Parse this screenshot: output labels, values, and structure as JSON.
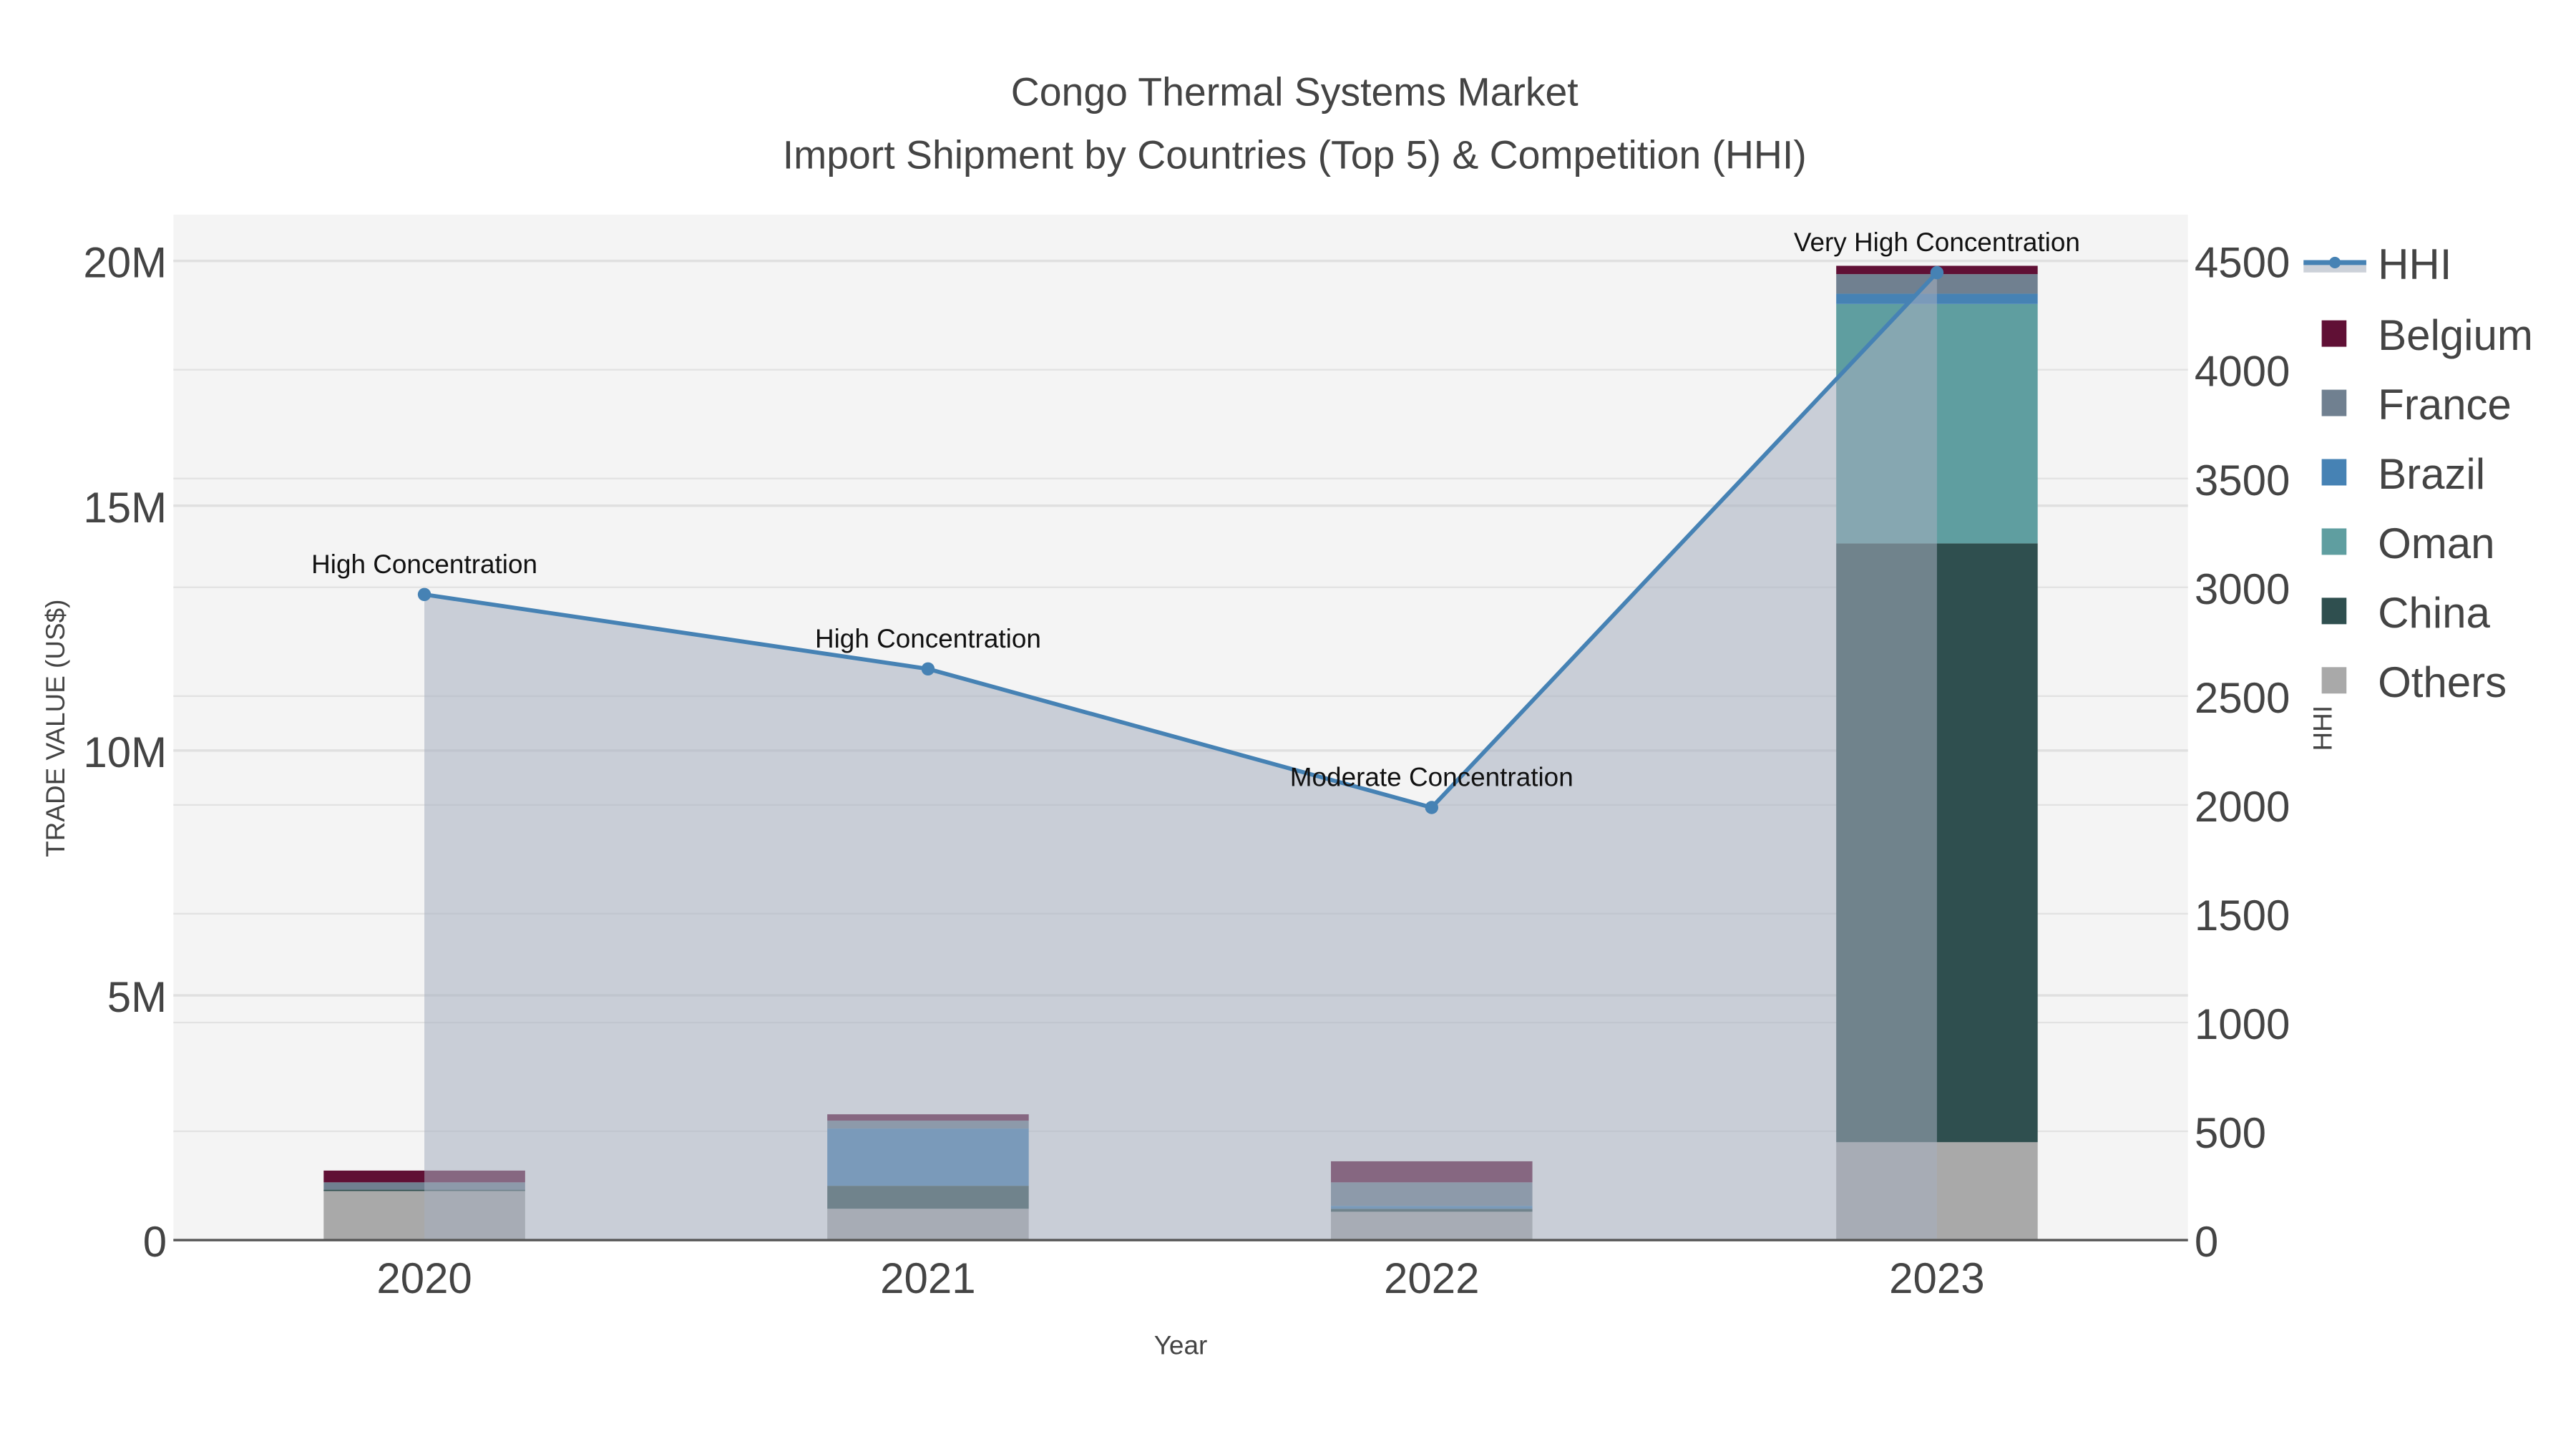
{
  "chart_data": {
    "type": "bar",
    "title": "Congo Thermal Systems Market",
    "subtitle": "Import Shipment by Countries (Top 5) & Competition (HHI)",
    "xlabel": "Year",
    "ylabel": "TRADE VALUE (US$)",
    "y2label": "HHI",
    "categories": [
      "2020",
      "2021",
      "2022",
      "2023"
    ],
    "ylim": [
      0,
      21000000
    ],
    "y2lim": [
      0,
      4725
    ],
    "yticks": [
      {
        "v": 0,
        "label": "0"
      },
      {
        "v": 5000000,
        "label": "5M"
      },
      {
        "v": 10000000,
        "label": "10M"
      },
      {
        "v": 15000000,
        "label": "15M"
      },
      {
        "v": 20000000,
        "label": "20M"
      }
    ],
    "y2ticks": [
      {
        "v": 0,
        "label": "0"
      },
      {
        "v": 500,
        "label": "500"
      },
      {
        "v": 1000,
        "label": "1000"
      },
      {
        "v": 1500,
        "label": "1500"
      },
      {
        "v": 2000,
        "label": "2000"
      },
      {
        "v": 2500,
        "label": "2500"
      },
      {
        "v": 3000,
        "label": "3000"
      },
      {
        "v": 3500,
        "label": "3500"
      },
      {
        "v": 4000,
        "label": "4000"
      },
      {
        "v": 4500,
        "label": "4500"
      }
    ],
    "series": [
      {
        "name": "Others",
        "color": "#a9a9a9",
        "values": [
          1020000,
          640000,
          580000,
          2000000
        ]
      },
      {
        "name": "China",
        "color": "#2f4f4f",
        "values": [
          10000,
          470000,
          60000,
          12230000
        ]
      },
      {
        "name": "Oman",
        "color": "#5f9ea0",
        "values": [
          0,
          0,
          0,
          4890000
        ]
      },
      {
        "name": "Brazil",
        "color": "#4682b4",
        "values": [
          0,
          1170000,
          60000,
          210000
        ]
      },
      {
        "name": "France",
        "color": "#708090",
        "values": [
          150000,
          160000,
          480000,
          400000
        ]
      },
      {
        "name": "Belgium",
        "color": "#601035",
        "values": [
          240000,
          130000,
          430000,
          170000
        ]
      }
    ],
    "hhi": {
      "name": "HHI",
      "color": "#4682b4",
      "values": [
        2967,
        2625,
        1988,
        4446
      ],
      "annotations": [
        "High Concentration",
        "High Concentration",
        "Moderate Concentration",
        "Very High Concentration"
      ]
    },
    "legend": [
      "HHI",
      "Belgium",
      "France",
      "Brazil",
      "Oman",
      "China",
      "Others"
    ],
    "legend_position": "right",
    "grid": true
  }
}
